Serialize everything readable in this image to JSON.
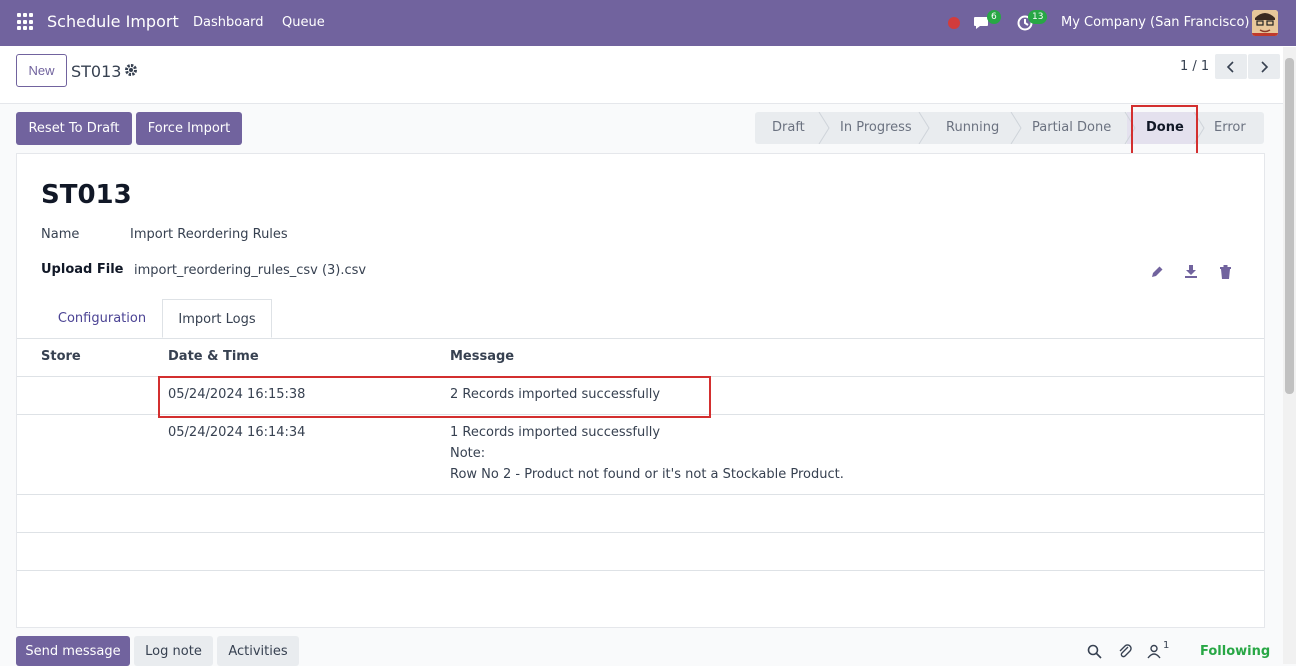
{
  "topbar": {
    "app_name": "Schedule Import",
    "nav": [
      "Dashboard",
      "Queue"
    ],
    "messages_count": "6",
    "activities_count": "13",
    "company": "My Company (San Francisco)"
  },
  "control_panel": {
    "new_label": "New",
    "record_name": "ST013",
    "pager": "1 / 1"
  },
  "actions": {
    "reset_label": "Reset To Draft",
    "force_label": "Force Import"
  },
  "statusbar": [
    "Draft",
    "In Progress",
    "Running",
    "Partial Done",
    "Done",
    "Error"
  ],
  "status_current": "Done",
  "form": {
    "title": "ST013",
    "name_label": "Name",
    "name_value": "Import Reordering Rules",
    "upload_label": "Upload File",
    "upload_value": "import_reordering_rules_csv (3).csv"
  },
  "tabs": [
    "Configuration",
    "Import Logs"
  ],
  "logs": {
    "headers": [
      "Store",
      "Date & Time",
      "Message"
    ],
    "rows": [
      {
        "store": "",
        "datetime": "05/24/2024 16:15:38",
        "message": [
          "2 Records imported successfully"
        ]
      },
      {
        "store": "",
        "datetime": "05/24/2024 16:14:34",
        "message": [
          "1 Records imported successfully",
          "Note:",
          "Row No 2  - Product not found or it's not a Stockable Product."
        ]
      }
    ]
  },
  "chatter": {
    "send_label": "Send message",
    "log_label": "Log note",
    "activities_label": "Activities",
    "followers_count": "1",
    "following_label": "Following"
  },
  "colors": {
    "brand": "#71639e",
    "highlight": "#d32f2f",
    "success": "#28a745"
  }
}
